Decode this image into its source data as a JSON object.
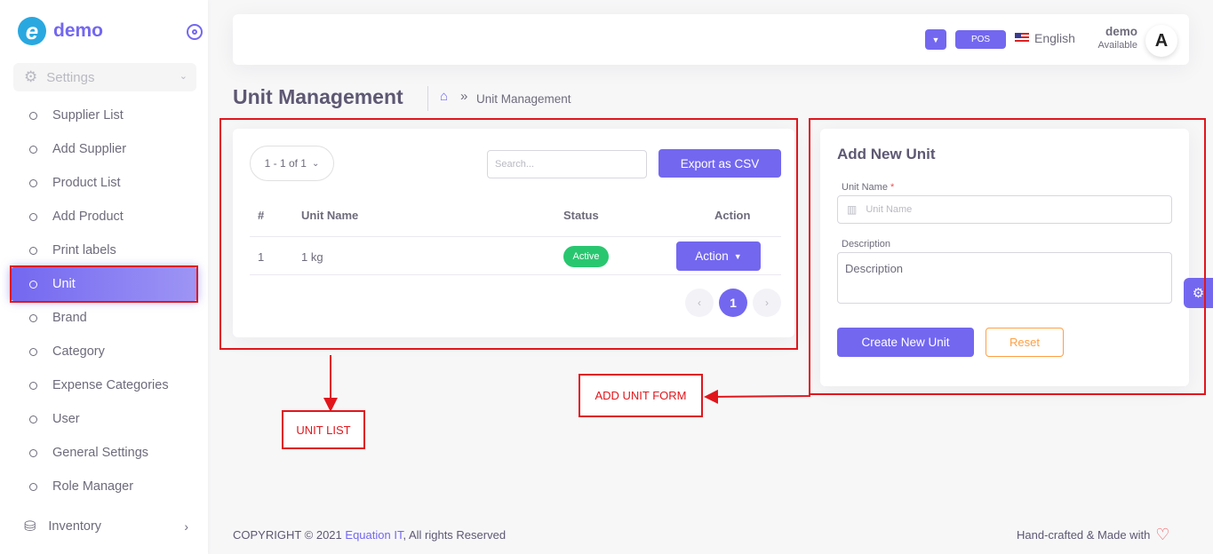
{
  "app": {
    "brand_logo_letter": "e",
    "brand_name": "demo"
  },
  "sidebar": {
    "group_label": "Settings",
    "items": [
      {
        "label": "Supplier List"
      },
      {
        "label": "Add Supplier"
      },
      {
        "label": "Product List"
      },
      {
        "label": "Add Product"
      },
      {
        "label": "Print labels"
      },
      {
        "label": "Unit"
      },
      {
        "label": "Brand"
      },
      {
        "label": "Category"
      },
      {
        "label": "Expense Categories"
      },
      {
        "label": "User"
      },
      {
        "label": "General Settings"
      },
      {
        "label": "Role Manager"
      }
    ],
    "active_item": "Unit",
    "inventory_label": "Inventory"
  },
  "navbar": {
    "pos_label": "POS",
    "language": "English",
    "user_name": "demo",
    "user_status": "Available",
    "avatar_letter": "A"
  },
  "page": {
    "title": "Unit Management",
    "breadcrumb_sep": "»",
    "breadcrumb_current": "Unit Management"
  },
  "unit_list": {
    "pager_text": "1 - 1 of 1",
    "search_placeholder": "Search...",
    "export_label": "Export as CSV",
    "columns": {
      "num": "#",
      "name": "Unit Name",
      "status": "Status",
      "action": "Action"
    },
    "rows": [
      {
        "num": "1",
        "name": "1 kg",
        "status": "Active",
        "action": "Action"
      }
    ],
    "current_page": "1"
  },
  "unit_form": {
    "title": "Add New Unit",
    "name_label": "Unit Name",
    "name_required": "*",
    "name_placeholder": "Unit Name",
    "description_label": "Description",
    "description_placeholder": "Description",
    "create_label": "Create New Unit",
    "reset_label": "Reset"
  },
  "annotations": {
    "unit_list": "UNIT LIST",
    "add_unit_form": "ADD UNIT FORM"
  },
  "footer": {
    "copyright": "COPYRIGHT © 2021",
    "company": "Equation IT",
    "rights": ", All rights Reserved",
    "made_with": "Hand-crafted & Made with"
  },
  "colors": {
    "primary": "#7367f0",
    "success": "#28c76f",
    "warning": "#ff9f43",
    "annotation": "#e0161c"
  }
}
